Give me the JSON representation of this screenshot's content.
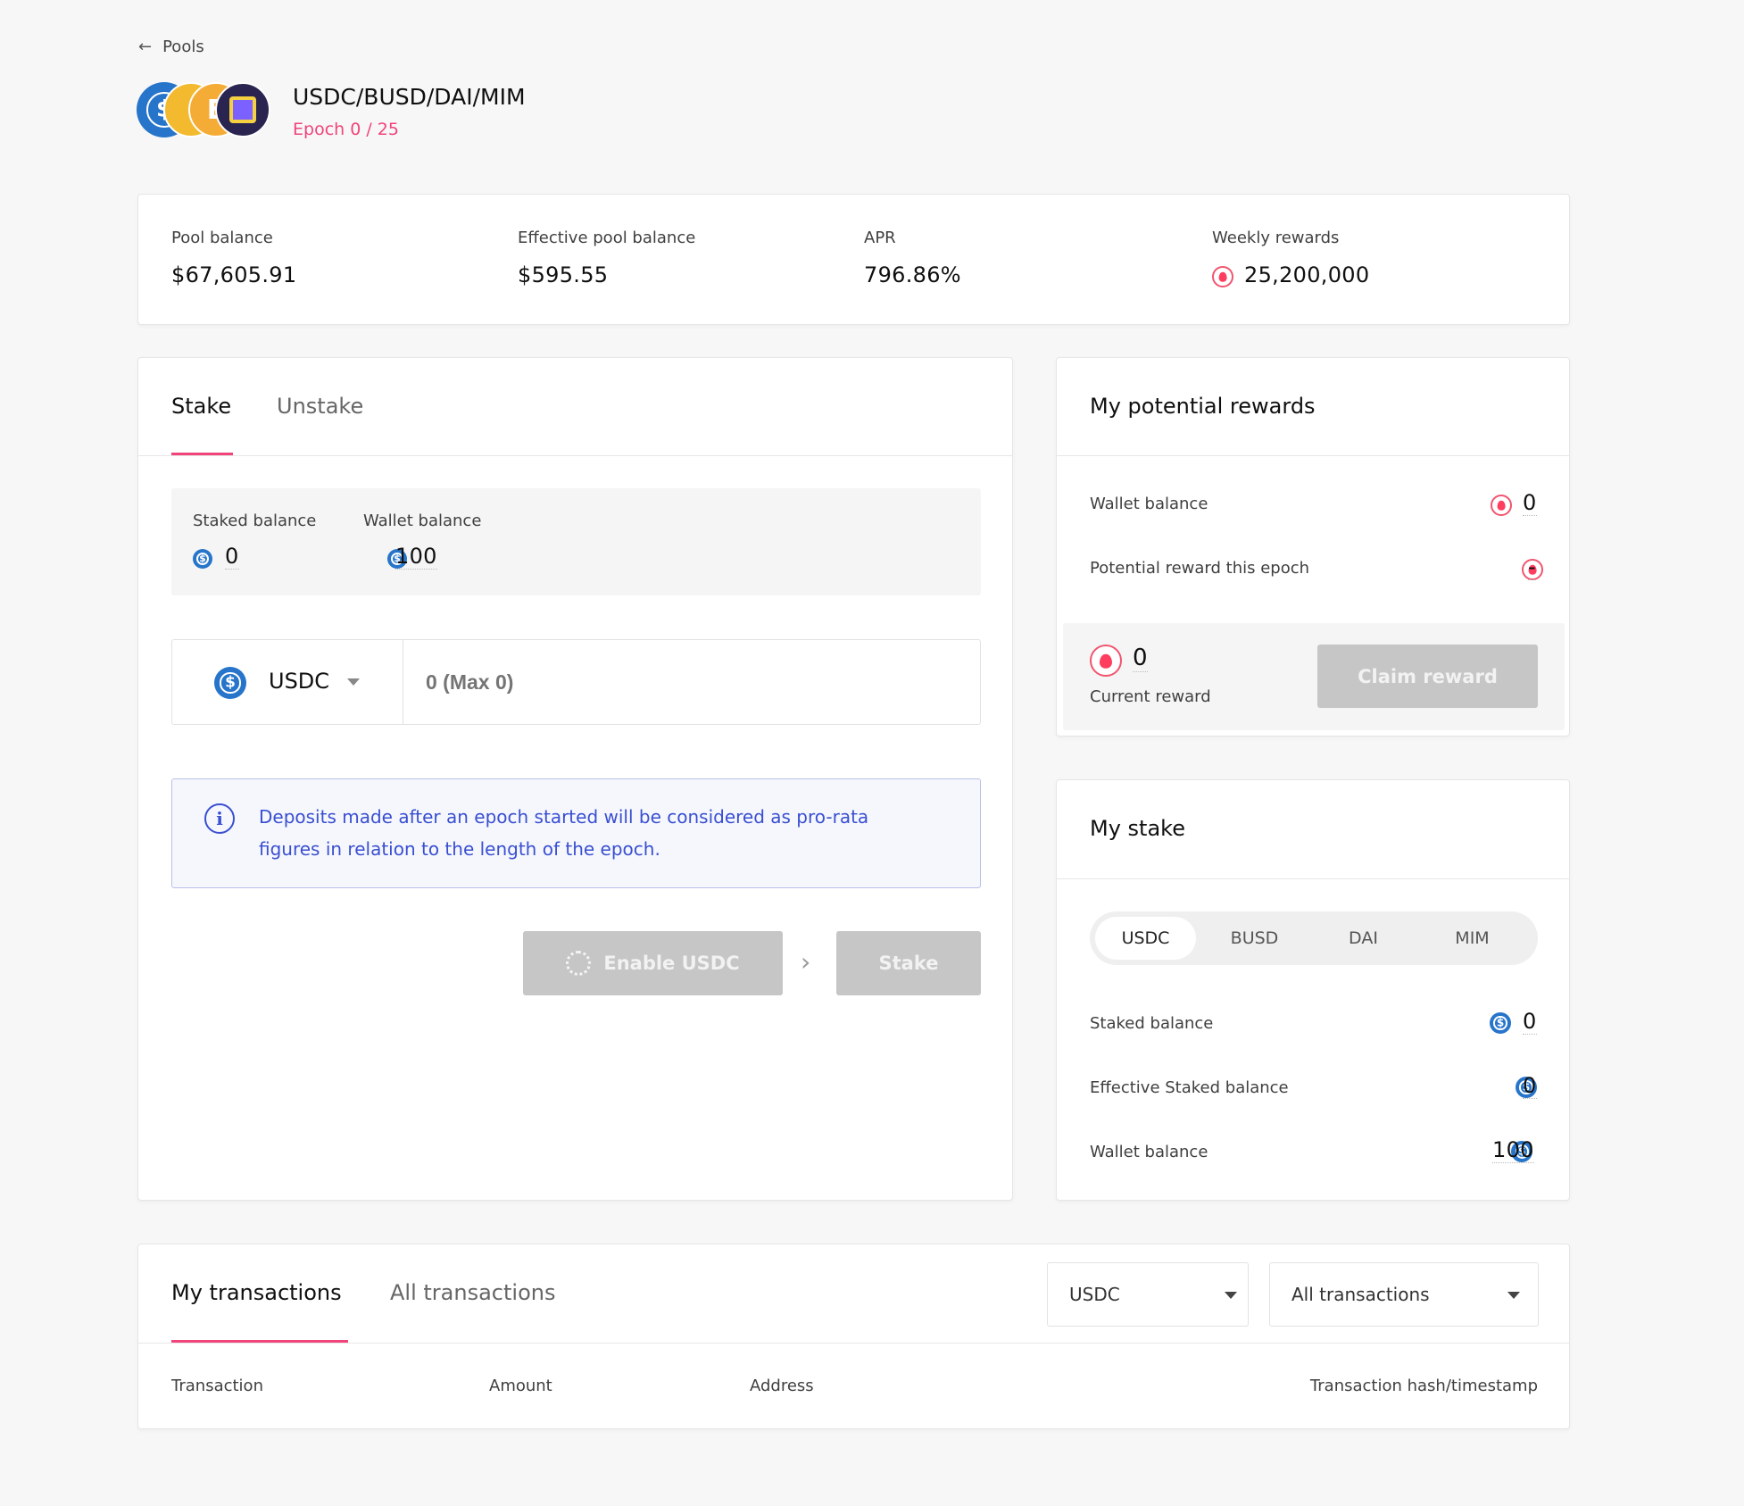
{
  "breadcrumb": {
    "label": "Pools"
  },
  "pool": {
    "name": "USDC/BUSD/DAI/MIM",
    "epoch": "Epoch 0 / 25"
  },
  "stats": {
    "pool_balance_label": "Pool balance",
    "pool_balance_value": "$67,605.91",
    "effective_label": "Effective pool balance",
    "effective_value": "$595.55",
    "apr_label": "APR",
    "apr_value": "796.86%",
    "weekly_label": "Weekly rewards",
    "weekly_value": "25,200,000"
  },
  "stake_panel": {
    "tabs": [
      "Stake",
      "Unstake"
    ],
    "staked_balance_label": "Staked balance",
    "staked_balance_value": "0",
    "wallet_balance_label": "Wallet balance",
    "wallet_balance_value": "100",
    "token_select": "USDC",
    "amount_placeholder": "0 (Max 0)",
    "info_text_line1": "Deposits made after an epoch started will be considered as pro-rata",
    "info_text_line2": "figures in relation to the length of the epoch.",
    "enable_button": "Enable USDC",
    "stake_button": "Stake"
  },
  "rewards": {
    "title": "My potential rewards",
    "wallet_label": "Wallet balance",
    "wallet_value": "0",
    "potential_label": "Potential reward this epoch",
    "potential_value": "-",
    "current_value": "0",
    "current_label": "Current reward",
    "claim_button": "Claim reward"
  },
  "my_stake": {
    "title": "My stake",
    "tokens": [
      "USDC",
      "BUSD",
      "DAI",
      "MIM"
    ],
    "selected_token": "USDC",
    "staked_label": "Staked balance",
    "staked_value": "0",
    "effective_label": "Effective Staked balance",
    "effective_value": "0",
    "wallet_label": "Wallet balance",
    "wallet_value": "100"
  },
  "transactions": {
    "tabs": [
      "My transactions",
      "All transactions"
    ],
    "token_filter": "USDC",
    "type_filter": "All transactions",
    "columns": [
      "Transaction",
      "Amount",
      "Address",
      "Transaction hash/timestamp"
    ]
  },
  "colors": {
    "accent_pink": "#f0447a",
    "usdc_blue": "#2775ca",
    "info_blue": "#3a4fd1",
    "disabled_gray": "#c6c6c6"
  }
}
